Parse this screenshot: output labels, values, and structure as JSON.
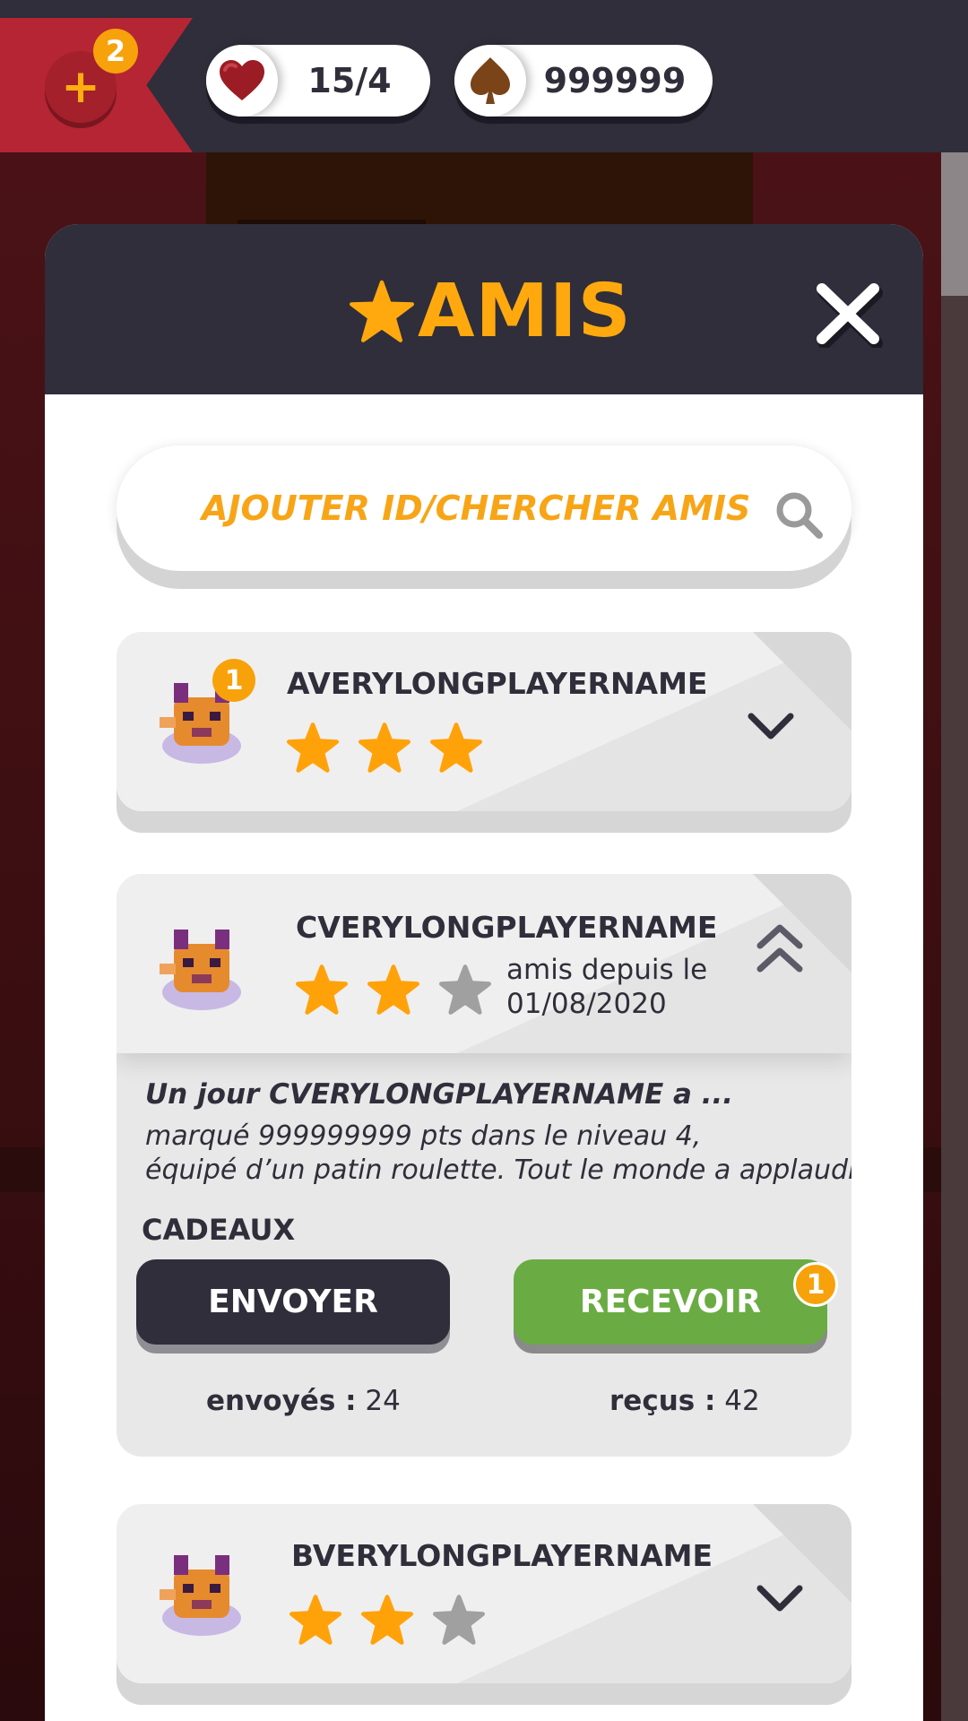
{
  "topbar": {
    "plus_icon": "plus-icon",
    "plus_badge": "2",
    "hearts": {
      "icon": "heart-icon",
      "value": "15/4"
    },
    "coins": {
      "icon": "spade-icon",
      "value": "999999"
    }
  },
  "modal": {
    "title": "AMIS",
    "title_icon": "star-icon",
    "close_icon": "close-icon"
  },
  "search": {
    "placeholder": "AJOUTER ID/CHERCHER AMIS",
    "icon": "search-icon"
  },
  "friends": [
    {
      "name": "AVERYLONGPLAYERNAME",
      "stars": 3,
      "badge": "1",
      "expanded": false
    },
    {
      "name": "CVERYLONGPLAYERNAME",
      "stars": 2,
      "since_label": "amis depuis le",
      "since_date": "01/08/2020",
      "expanded": true,
      "story_title": "Un jour CVERYLONGPLAYERNAME a ...",
      "story_line1": "marqué 999999999 pts dans le niveau 4,",
      "story_line2": "équipé d’un patin roulette. Tout le monde a applaudis.",
      "gifts_label": "CADEAUX",
      "send_label": "ENVOYER",
      "receive_label": "RECEVOIR",
      "receive_badge": "1",
      "sent_label": "envoyés :",
      "sent_count": "24",
      "received_label": "reçus :",
      "received_count": "42"
    },
    {
      "name": "BVERYLONGPLAYERNAME",
      "stars": 2,
      "expanded": false
    }
  ],
  "colors": {
    "accent": "#ffa90f",
    "dark": "#2f2e3a",
    "red": "#b52533",
    "green": "#6aac43",
    "star_gray": "#a0a0a0"
  }
}
